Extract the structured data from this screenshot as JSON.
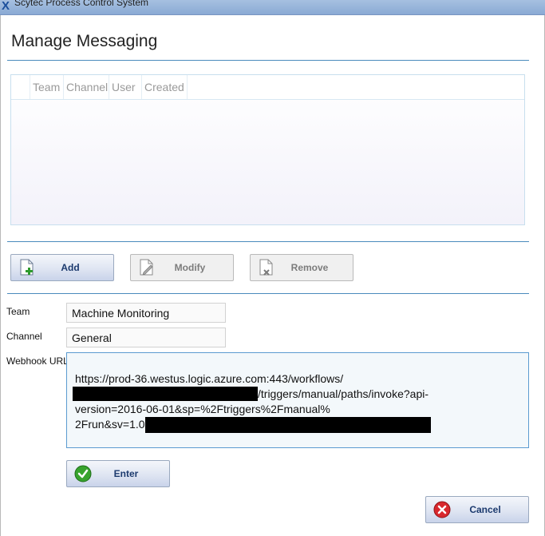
{
  "window": {
    "title": "Scytec Process Control System"
  },
  "page": {
    "title": "Manage Messaging"
  },
  "grid": {
    "columns": [
      "Team",
      "Channel",
      "User",
      "Created"
    ]
  },
  "toolbar": {
    "add_label": "Add",
    "modify_label": "Modify",
    "remove_label": "Remove"
  },
  "form": {
    "team_label": "Team",
    "team_value": "Machine Monitoring",
    "channel_label": "Channel",
    "channel_value": "General",
    "webhook_label": "Webhook URL",
    "webhook_lines": [
      "https://prod-36.westus.logic.azure.com:443/workflows/",
      "/triggers/manual/paths/invoke?api-",
      "version=2016-06-01&sp=%2Ftriggers%2Fmanual%",
      "2Frun&sv=1.0"
    ]
  },
  "actions": {
    "enter_label": "Enter",
    "cancel_label": "Cancel"
  },
  "colors": {
    "accent_rule": "#4a8bbd",
    "button_text": "#1c3a6e",
    "input_focus_border": "#5b9bd0"
  },
  "icons": [
    "app-logo-icon",
    "add-document-icon",
    "edit-document-icon",
    "remove-document-icon",
    "check-icon",
    "cancel-icon"
  ]
}
